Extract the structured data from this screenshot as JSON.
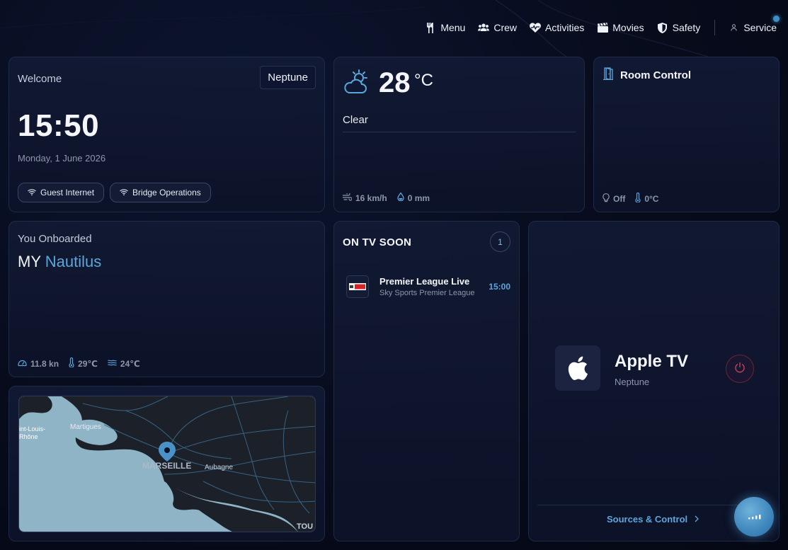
{
  "nav": {
    "items": [
      {
        "label": "Menu",
        "icon": "utensils-icon"
      },
      {
        "label": "Crew",
        "icon": "users-icon"
      },
      {
        "label": "Activities",
        "icon": "heart-pulse-icon"
      },
      {
        "label": "Movies",
        "icon": "clapperboard-icon"
      },
      {
        "label": "Safety",
        "icon": "shield-icon"
      }
    ],
    "service_label": "Service"
  },
  "welcome": {
    "title": "Welcome",
    "ship": "Neptune",
    "time": "15:50",
    "date": "Monday, 1 June 2026",
    "chips": [
      "Guest Internet",
      "Bridge Operations"
    ]
  },
  "weather": {
    "temp": "28",
    "unit": "°C",
    "condition": "Clear",
    "wind": "16 km/h",
    "rain": "0 mm"
  },
  "room": {
    "title": "Room Control",
    "light": "Off",
    "temp": "0°C"
  },
  "onboard": {
    "title": "You Onboarded",
    "prefix": "MY",
    "yacht": "Nautilus",
    "speed": "11.8 kn",
    "air_temp": "29℃",
    "water_temp": "24℃"
  },
  "map": {
    "labels": {
      "marseille": "MARSEILLE",
      "aubagne": "Aubagne",
      "martigues": "Martigues",
      "saint_louis": "int-Louis-",
      "saint_louis_2": "Rhône",
      "toulon": "TOU"
    }
  },
  "tv_soon": {
    "title": "ON TV SOON",
    "count": "1",
    "programs": [
      {
        "title": "Premier League Live",
        "channel": "Sky Sports Premier League",
        "time": "15:00"
      }
    ]
  },
  "apple_tv": {
    "name": "Apple TV",
    "room": "Neptune",
    "sources_label": "Sources & Control"
  },
  "colors": {
    "accent": "#5aa7dc",
    "background": "#070b1b",
    "card": "#111a35",
    "power_red": "#c44a5a"
  }
}
